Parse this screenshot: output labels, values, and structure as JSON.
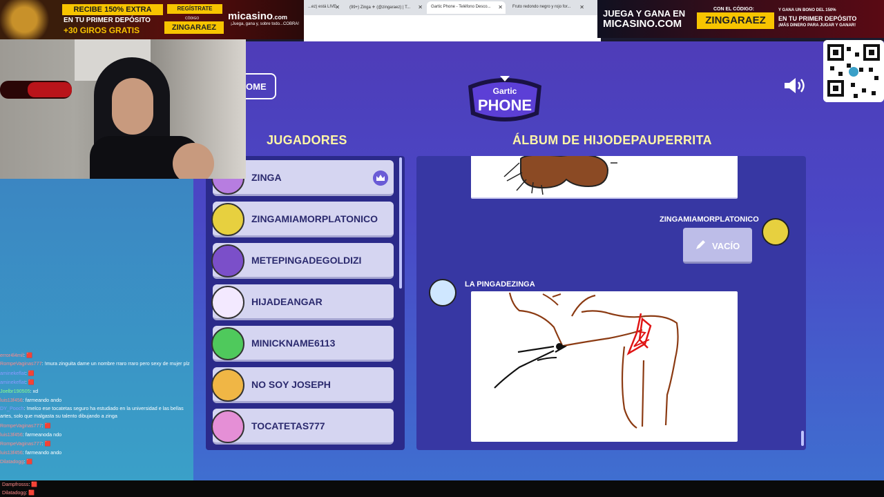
{
  "browser": {
    "tabs": [
      {
        "label": "...ez) está LIVE",
        "active": false
      },
      {
        "label": "(99+) Zinga ✈ (@zingaraez) | T...",
        "active": false
      },
      {
        "label": "Gartic Phone - Teléfono Desco...",
        "active": true
      },
      {
        "label": "Fruto redondo negro y rojo for...",
        "active": false
      }
    ]
  },
  "game": {
    "home_label": "OME",
    "logo_top": "Gartic",
    "logo_bottom": "PHONE",
    "players_heading": "JUGADORES",
    "album_heading": "ÁLBUM DE HIJODEPAUPERRITA",
    "players": [
      {
        "name": "ZINGA",
        "host": true
      },
      {
        "name": "ZINGAMIAMORPLATONICO",
        "host": false
      },
      {
        "name": "METEPINGADEGOLDIZI",
        "host": false
      },
      {
        "name": "HIJADEANGAR",
        "host": false
      },
      {
        "name": "MINICKNAME6113",
        "host": false
      },
      {
        "name": "NO SOY JOSEPH",
        "host": false
      },
      {
        "name": "TOCATETAS777",
        "host": false
      }
    ],
    "album": {
      "entry1_author": "ZINGAMIAMORPLATONICO",
      "entry1_empty": "VACÍO",
      "entry2_author": "LA PINGADEZINGA"
    }
  },
  "ads": {
    "left": {
      "extra": "RECIBE 150% EXTRA",
      "first": "EN TU PRIMER DEPÓSITO",
      "giros": "+30 GIROS GRATIS",
      "register": "REGÍSTRATE",
      "codigo": "CÓDIGO",
      "code": "ZINGARAEZ",
      "brand": "micasino",
      "brand_suffix": ".com",
      "tagline": "¡Juega, gana y, sobre todo...COBRA!"
    },
    "right": {
      "line1": "JUEGA Y GANA EN",
      "site": "MICASINO.COM",
      "con": "CON EL CÓDIGO:",
      "code": "ZINGARAEZ",
      "r1": "Y GANA UN BONO DEL 150%",
      "r2": "EN TU PRIMER DEPÓSITO",
      "r3": "¡MÁS DINERO PARA JUGAR Y GANAR!"
    }
  },
  "chat": {
    "messages": [
      {
        "user": "error4l4mil",
        "text": ": 🟥"
      },
      {
        "user": "RompeVaginas777",
        "text": ": !mura zinguita dame un nombre rraro rraro pero sexy de mujer plz"
      },
      {
        "user": "aminekeflat",
        "text": ": 🟥"
      },
      {
        "user": "aminekeflat",
        "text": ": 🟥"
      },
      {
        "user": "Joelbr190505",
        "text": ": xd"
      },
      {
        "user": "luis13f456",
        "text": ": farmeando ando"
      },
      {
        "user": "DY_Pooch",
        "text": ": !melco ese tocatetas seguro ha estudiado en la universidad e las bellas artes, solo que malgasta su talento dibujando a zinga"
      },
      {
        "user": "RompeVaginas777",
        "text": ": 🟥"
      },
      {
        "user": "luis13f456",
        "text": ": farmeanoda ndo"
      },
      {
        "user": "RompeVaginas777",
        "text": ": 🟥"
      },
      {
        "user": "luis13f456",
        "text": ": farmeando ando"
      },
      {
        "user": "Dilatadogg",
        "text": ": 🟥"
      },
      {
        "user": "Dampfrosss",
        "text": ": 🟥"
      },
      {
        "user": "Dilatadogg",
        "text": ": 🟥"
      }
    ]
  },
  "colors": {
    "heading": "#fff6a6",
    "player_card": "#d5d5f1",
    "panel": "#2b2a8a",
    "accent_yellow": "#f7c400"
  }
}
